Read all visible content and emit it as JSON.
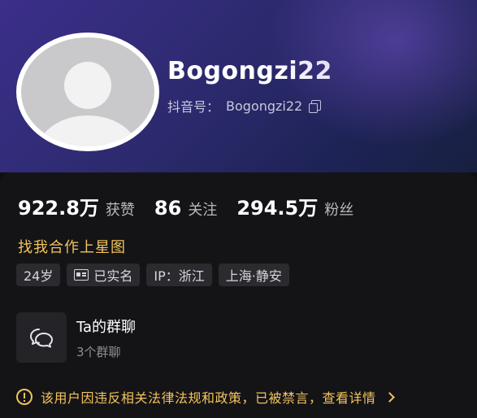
{
  "profile": {
    "username": "Bogongzi22",
    "id_label": "抖音号：",
    "id_value": "Bogongzi22",
    "copy_icon": "copy-icon",
    "avatar_icon": "default-avatar-icon"
  },
  "stats": [
    {
      "value": "922.8万",
      "label": "获赞"
    },
    {
      "value": "86",
      "label": "关注"
    },
    {
      "value": "294.5万",
      "label": "粉丝"
    }
  ],
  "partner_link": "找我合作上星图",
  "tags": {
    "age": "24岁",
    "verified": "已实名",
    "ip": "IP：浙江",
    "location": "上海·静安"
  },
  "group_chat": {
    "title": "Ta的群聊",
    "count": "3个群聊",
    "icon": "chat-bubbles-icon"
  },
  "warning": {
    "text": "该用户因违反相关法律法规和政策，已被禁言，查看详情",
    "icon": "exclamation-circle-icon"
  },
  "colors": {
    "accent_gold": "#f3c35b",
    "panel_bg": "#141417",
    "tag_bg": "#2a2a2f"
  }
}
